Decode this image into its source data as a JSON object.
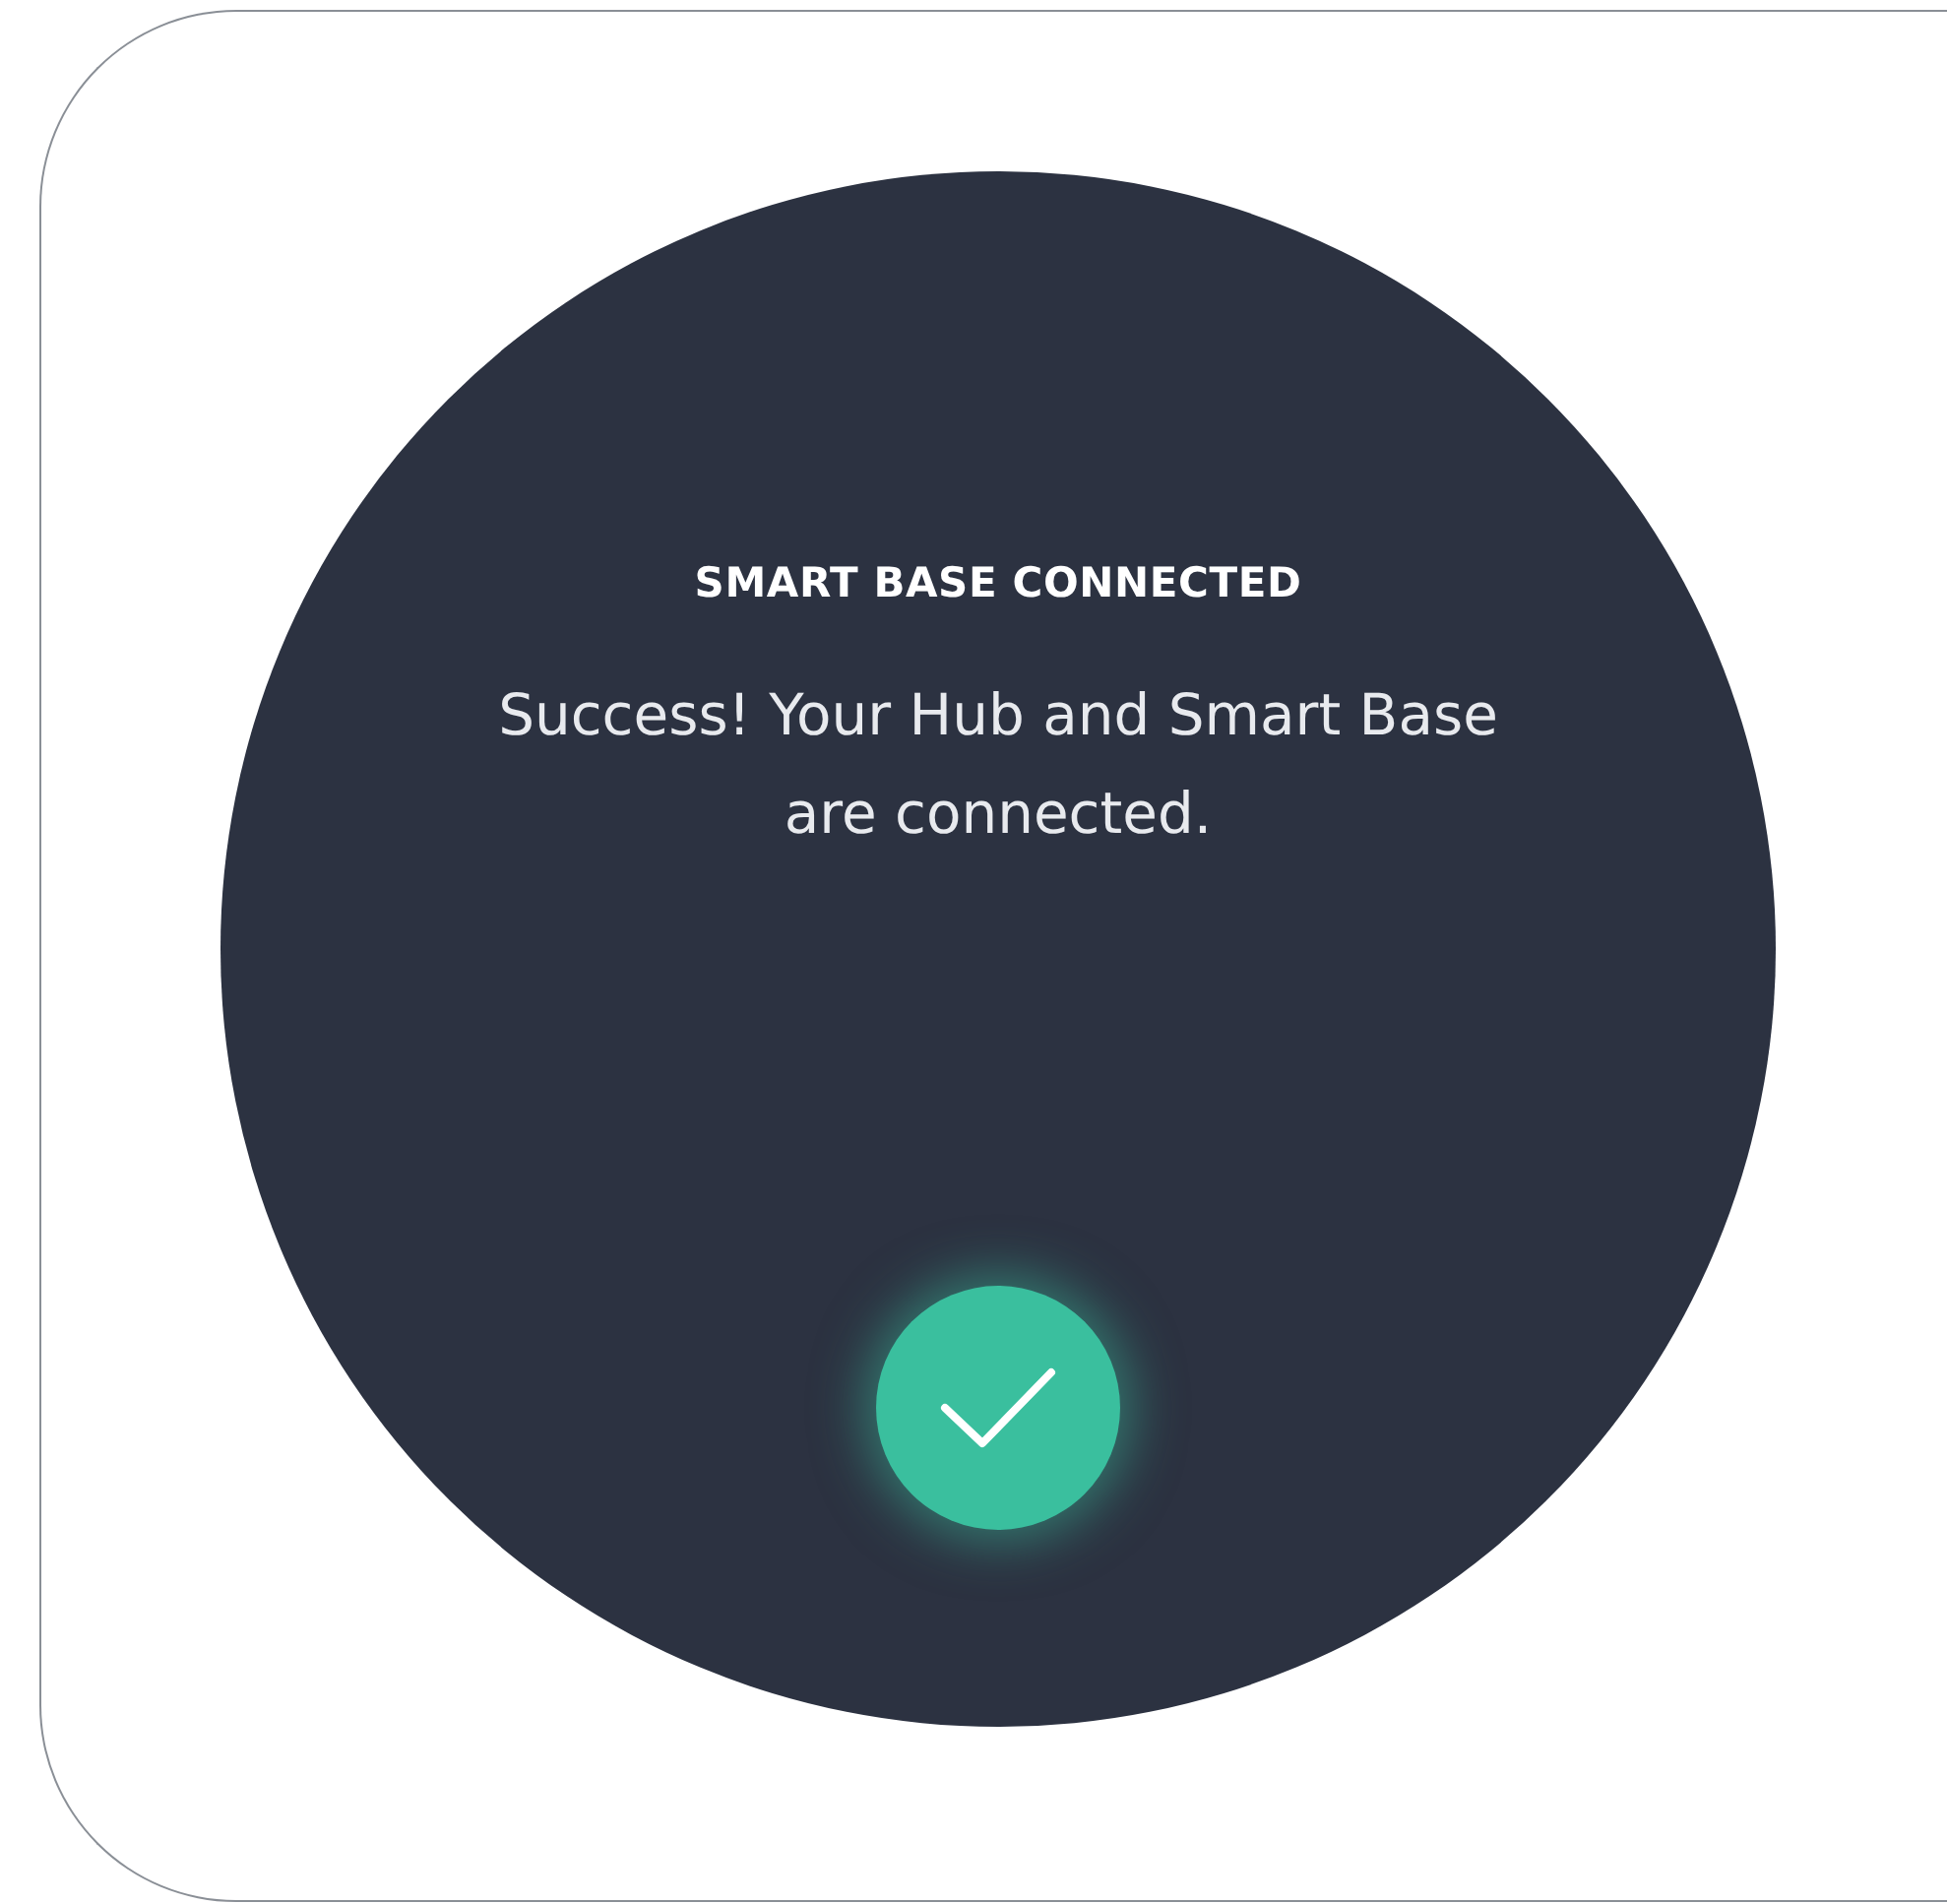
{
  "dialog": {
    "title": "SMART BASE CONNECTED",
    "message": "Success! Your Hub and Smart Base are connected.",
    "status": {
      "kind": "success"
    }
  }
}
